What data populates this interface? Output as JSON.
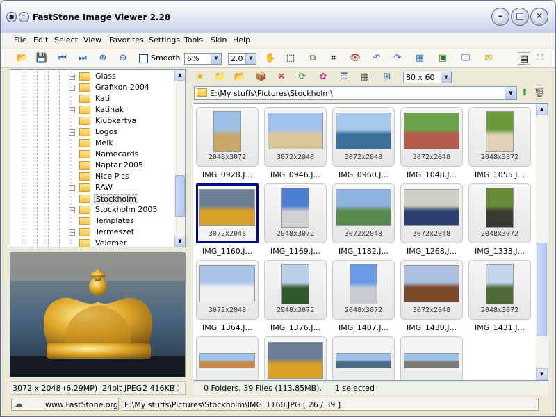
{
  "window": {
    "title": "FastStone Image Viewer 2.28"
  },
  "menu": [
    "File",
    "Edit",
    "Select",
    "View",
    "Favorites",
    "Settings",
    "Tools",
    "Skin",
    "Help"
  ],
  "toolbar": {
    "smooth_label": "Smooth",
    "zoom_value": "6%",
    "ratio_value": "2.0"
  },
  "tree": {
    "items": [
      {
        "label": "Glass",
        "expand": "+"
      },
      {
        "label": "Grafikon 2004",
        "expand": "+"
      },
      {
        "label": "Kati",
        "expand": ""
      },
      {
        "label": "Katinak",
        "expand": "+"
      },
      {
        "label": "Klubkartya",
        "expand": ""
      },
      {
        "label": "Logos",
        "expand": "+"
      },
      {
        "label": "Melk",
        "expand": ""
      },
      {
        "label": "Namecards",
        "expand": ""
      },
      {
        "label": "Naptar 2005",
        "expand": ""
      },
      {
        "label": "Nice Pics",
        "expand": ""
      },
      {
        "label": "RAW",
        "expand": "+"
      },
      {
        "label": "Stockholm",
        "expand": ""
      },
      {
        "label": "Stockholm 2005",
        "expand": "+"
      },
      {
        "label": "Templates",
        "expand": ""
      },
      {
        "label": "Termeszet",
        "expand": "+"
      },
      {
        "label": "Velemér",
        "expand": ""
      }
    ],
    "selected_index": 11
  },
  "browser": {
    "thumb_size": "80 x 60",
    "path": "E:\\My stuffs\\Pictures\\Stockholm\\",
    "thumbs": [
      {
        "name": "IMG_0928.J...",
        "dim": "2048x3072",
        "style": "portrait",
        "colors": [
          "#9cc0e6",
          "#c9a86a"
        ]
      },
      {
        "name": "IMG_0946.J...",
        "dim": "3072x2048",
        "style": "landscape",
        "colors": [
          "#9fc2ee",
          "#d8c79a"
        ]
      },
      {
        "name": "IMG_0960.J...",
        "dim": "3072x2048",
        "style": "landscape",
        "colors": [
          "#a8c8ea",
          "#3c6f9a"
        ]
      },
      {
        "name": "IMG_1048.J...",
        "dim": "3072x2048",
        "style": "landscape",
        "colors": [
          "#6aa34a",
          "#b55a4a"
        ]
      },
      {
        "name": "IMG_1055.J...",
        "dim": "2048x3072",
        "style": "portrait",
        "colors": [
          "#6b9a3b",
          "#e2d2b8"
        ]
      },
      {
        "name": "IMG_1160.J...",
        "dim": "3072x2048",
        "style": "landscape",
        "colors": [
          "#6c7d94",
          "#d8a22a"
        ]
      },
      {
        "name": "IMG_1169.J...",
        "dim": "2048x3072",
        "style": "portrait",
        "colors": [
          "#4d7fd4",
          "#d0d0d0"
        ]
      },
      {
        "name": "IMG_1182.J...",
        "dim": "3072x2048",
        "style": "landscape",
        "colors": [
          "#8cb2de",
          "#5a8a4e"
        ]
      },
      {
        "name": "IMG_1268.J...",
        "dim": "3072x2048",
        "style": "landscape",
        "colors": [
          "#cfcfc4",
          "#2c3e70"
        ]
      },
      {
        "name": "IMG_1333.J...",
        "dim": "2048x3072",
        "style": "portrait",
        "colors": [
          "#6a8a3a",
          "#3a3a32"
        ]
      },
      {
        "name": "IMG_1364.J...",
        "dim": "3072x2048",
        "style": "landscape",
        "colors": [
          "#aac4e8",
          "#f0f0f0"
        ]
      },
      {
        "name": "IMG_1376.J...",
        "dim": "2048x3072",
        "style": "portrait",
        "colors": [
          "#bcd0ea",
          "#2f5a2c"
        ]
      },
      {
        "name": "IMG_1407.J...",
        "dim": "2048x3072",
        "style": "portrait",
        "colors": [
          "#6a9ce6",
          "#c8ccd2"
        ]
      },
      {
        "name": "IMG_1430.J...",
        "dim": "3072x2048",
        "style": "landscape",
        "colors": [
          "#aac0de",
          "#7a4a2a"
        ]
      },
      {
        "name": "IMG_1431.J...",
        "dim": "2048x3072",
        "style": "portrait",
        "colors": [
          "#c6d6ea",
          "#506a3a"
        ]
      },
      {
        "name": "",
        "dim": "",
        "style": "pano",
        "colors": [
          "#9ec2e8",
          "#c78a4a"
        ]
      },
      {
        "name": "",
        "dim": "",
        "style": "landscape",
        "colors": [
          "#6c7d94",
          "#d8a22a"
        ]
      },
      {
        "name": "",
        "dim": "",
        "style": "pano",
        "colors": [
          "#9ec2e8",
          "#4a6a8a"
        ]
      },
      {
        "name": "",
        "dim": "",
        "style": "pano",
        "colors": [
          "#9ec2e8",
          "#7a7a72"
        ]
      }
    ],
    "selected_index": 5
  },
  "status": {
    "image_info": "3072 x 2048 (6,29MP)",
    "format": "24bit JPEG",
    "size": "2 416KB",
    "folder_count": "0 Folders, 39 Files (113,85MB).",
    "selection": "1 selected"
  },
  "footer": {
    "website": "www.FastStone.org",
    "file_path": "E:\\My stuffs\\Pictures\\Stockholm\\IMG_1160.JPG [ 26 / 39 ]"
  }
}
